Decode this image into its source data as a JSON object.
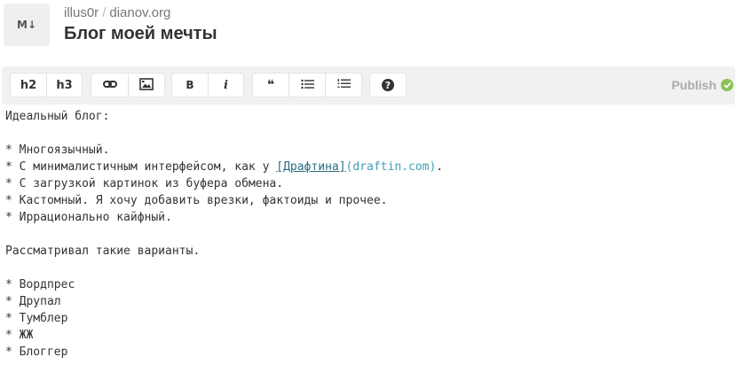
{
  "header": {
    "logo_text": "M↓",
    "user": "illus0r",
    "separator": "/",
    "site": "dianov.org",
    "title": "Блог моей мечты"
  },
  "toolbar": {
    "h2_label": "h2",
    "h3_label": "h3",
    "bold_label": "B",
    "italic_label": "i",
    "quote_label": "❝",
    "help_label": "?",
    "publish_label": "Publish",
    "icons": [
      "link-icon",
      "image-icon",
      "bullet-list-icon",
      "numbered-list-icon",
      "help-icon",
      "checkmark-icon"
    ],
    "accent_color": "#8cc152"
  },
  "editor": {
    "lines": [
      "Идеальный блог:",
      "",
      "* Многоязычный.",
      "* С минималистичным интерфейсом, как у ",
      "* С загрузкой картинок из буфера обмена.",
      "* Кастомный. Я хочу добавить врезки, фактоиды и прочее.",
      "* Иррационально кайфный.",
      "",
      "Рассматривал такие варианты.",
      "",
      "* Вордпрес",
      "* Друпал",
      "* Тумблер",
      "* ЖЖ",
      "* Блоггер"
    ],
    "link_text": "[Драфтина]",
    "link_url": "(draftin.com)",
    "link_suffix": "."
  }
}
